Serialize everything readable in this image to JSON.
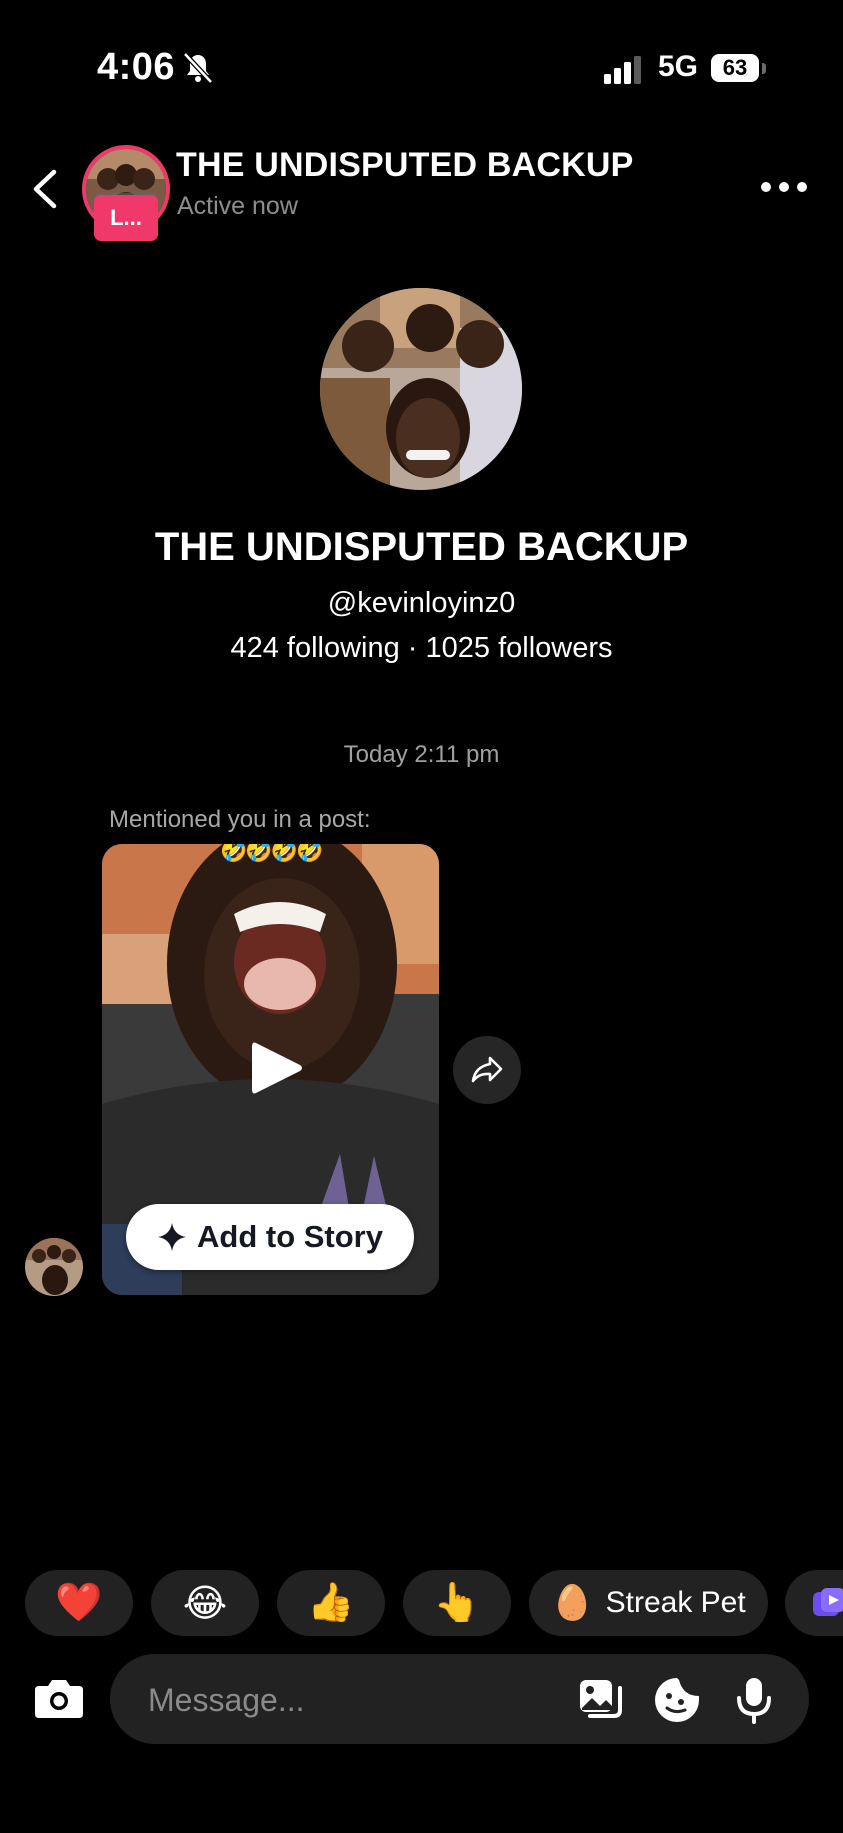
{
  "status": {
    "time": "4:06",
    "network": "5G",
    "battery": "63"
  },
  "header": {
    "title": "THE UNDISPUTED BACKUP",
    "subtitle": "Active now",
    "badge": "L..."
  },
  "profile": {
    "name": "THE UNDISPUTED BACKUP",
    "handle": "@kevinloyinz0",
    "stats": "424 following · 1025 followers"
  },
  "chat": {
    "timestamp": "Today 2:11 pm",
    "mention_text": "Mentioned you in a post:",
    "post_emojis": "🤣🤣🤣🤣",
    "add_to_story": "Add to Story"
  },
  "quick_replies": [
    {
      "emoji": "❤️",
      "label": ""
    },
    {
      "emoji": "😂",
      "label": ""
    },
    {
      "emoji": "👍",
      "label": ""
    },
    {
      "emoji": "👆",
      "label": ""
    },
    {
      "emoji": "🥚",
      "label": "Streak Pet"
    }
  ],
  "composer": {
    "placeholder": "Message..."
  },
  "colors": {
    "accent": "#f0386b",
    "background": "#000000",
    "chip": "#222222"
  }
}
